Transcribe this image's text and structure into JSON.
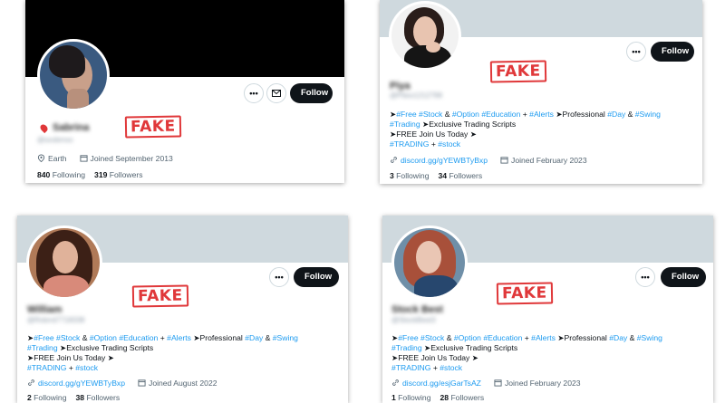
{
  "stamp_text": "FAKE",
  "colors": {
    "accent": "#1d9bf0",
    "stamp": "#e0383a",
    "follow_bg": "#0f1419",
    "banner_light": "#cfd9de"
  },
  "profiles": [
    {
      "follow_label": "Follow",
      "location": "Earth",
      "joined": "Joined September 2013",
      "following_count": "840",
      "following_label": "Following",
      "followers_count": "319",
      "followers_label": "Followers"
    },
    {
      "follow_label": "Follow",
      "bio": {
        "line1": [
          "➤",
          "#Free",
          "#Stock",
          "&",
          "#Option",
          "#Education",
          "+",
          "#Alerts",
          "➤Professional",
          "#Day",
          "&",
          "#Swing"
        ],
        "line2_tag": "#Trading",
        "line2_text": "➤Exclusive Trading Scripts",
        "line3": "➤FREE Join Us Today ➤",
        "line4_tag1": "#TRADING",
        "line4_plus": "+",
        "line4_tag2": "#stock"
      },
      "link": "discord.gg/gYEWBTyBxp",
      "joined": "Joined February 2023",
      "following_count": "3",
      "following_label": "Following",
      "followers_count": "34",
      "followers_label": "Followers"
    },
    {
      "follow_label": "Follow",
      "bio": {
        "line2_tag": "#Trading",
        "line2_text": "➤Exclusive Trading Scripts",
        "line3": "➤FREE Join Us Today ➤",
        "line4_tag1": "#TRADING",
        "line4_plus": "+",
        "line4_tag2": "#stock"
      },
      "link": "discord.gg/gYEWBTyBxp",
      "joined": "Joined August 2022",
      "following_count": "2",
      "following_label": "Following",
      "followers_count": "38",
      "followers_label": "Followers"
    },
    {
      "follow_label": "Follow",
      "bio": {
        "line2_tag": "#Trading",
        "line2_text": "➤Exclusive Trading Scripts",
        "line3": "➤FREE Join Us Today ➤",
        "line4_tag1": "#TRADING",
        "line4_plus": "+",
        "line4_tag2": "#stock"
      },
      "link": "discord.gg/esjGarTsAZ",
      "joined": "Joined February 2023",
      "following_count": "1",
      "following_label": "Following",
      "followers_count": "28",
      "followers_label": "Followers"
    }
  ]
}
